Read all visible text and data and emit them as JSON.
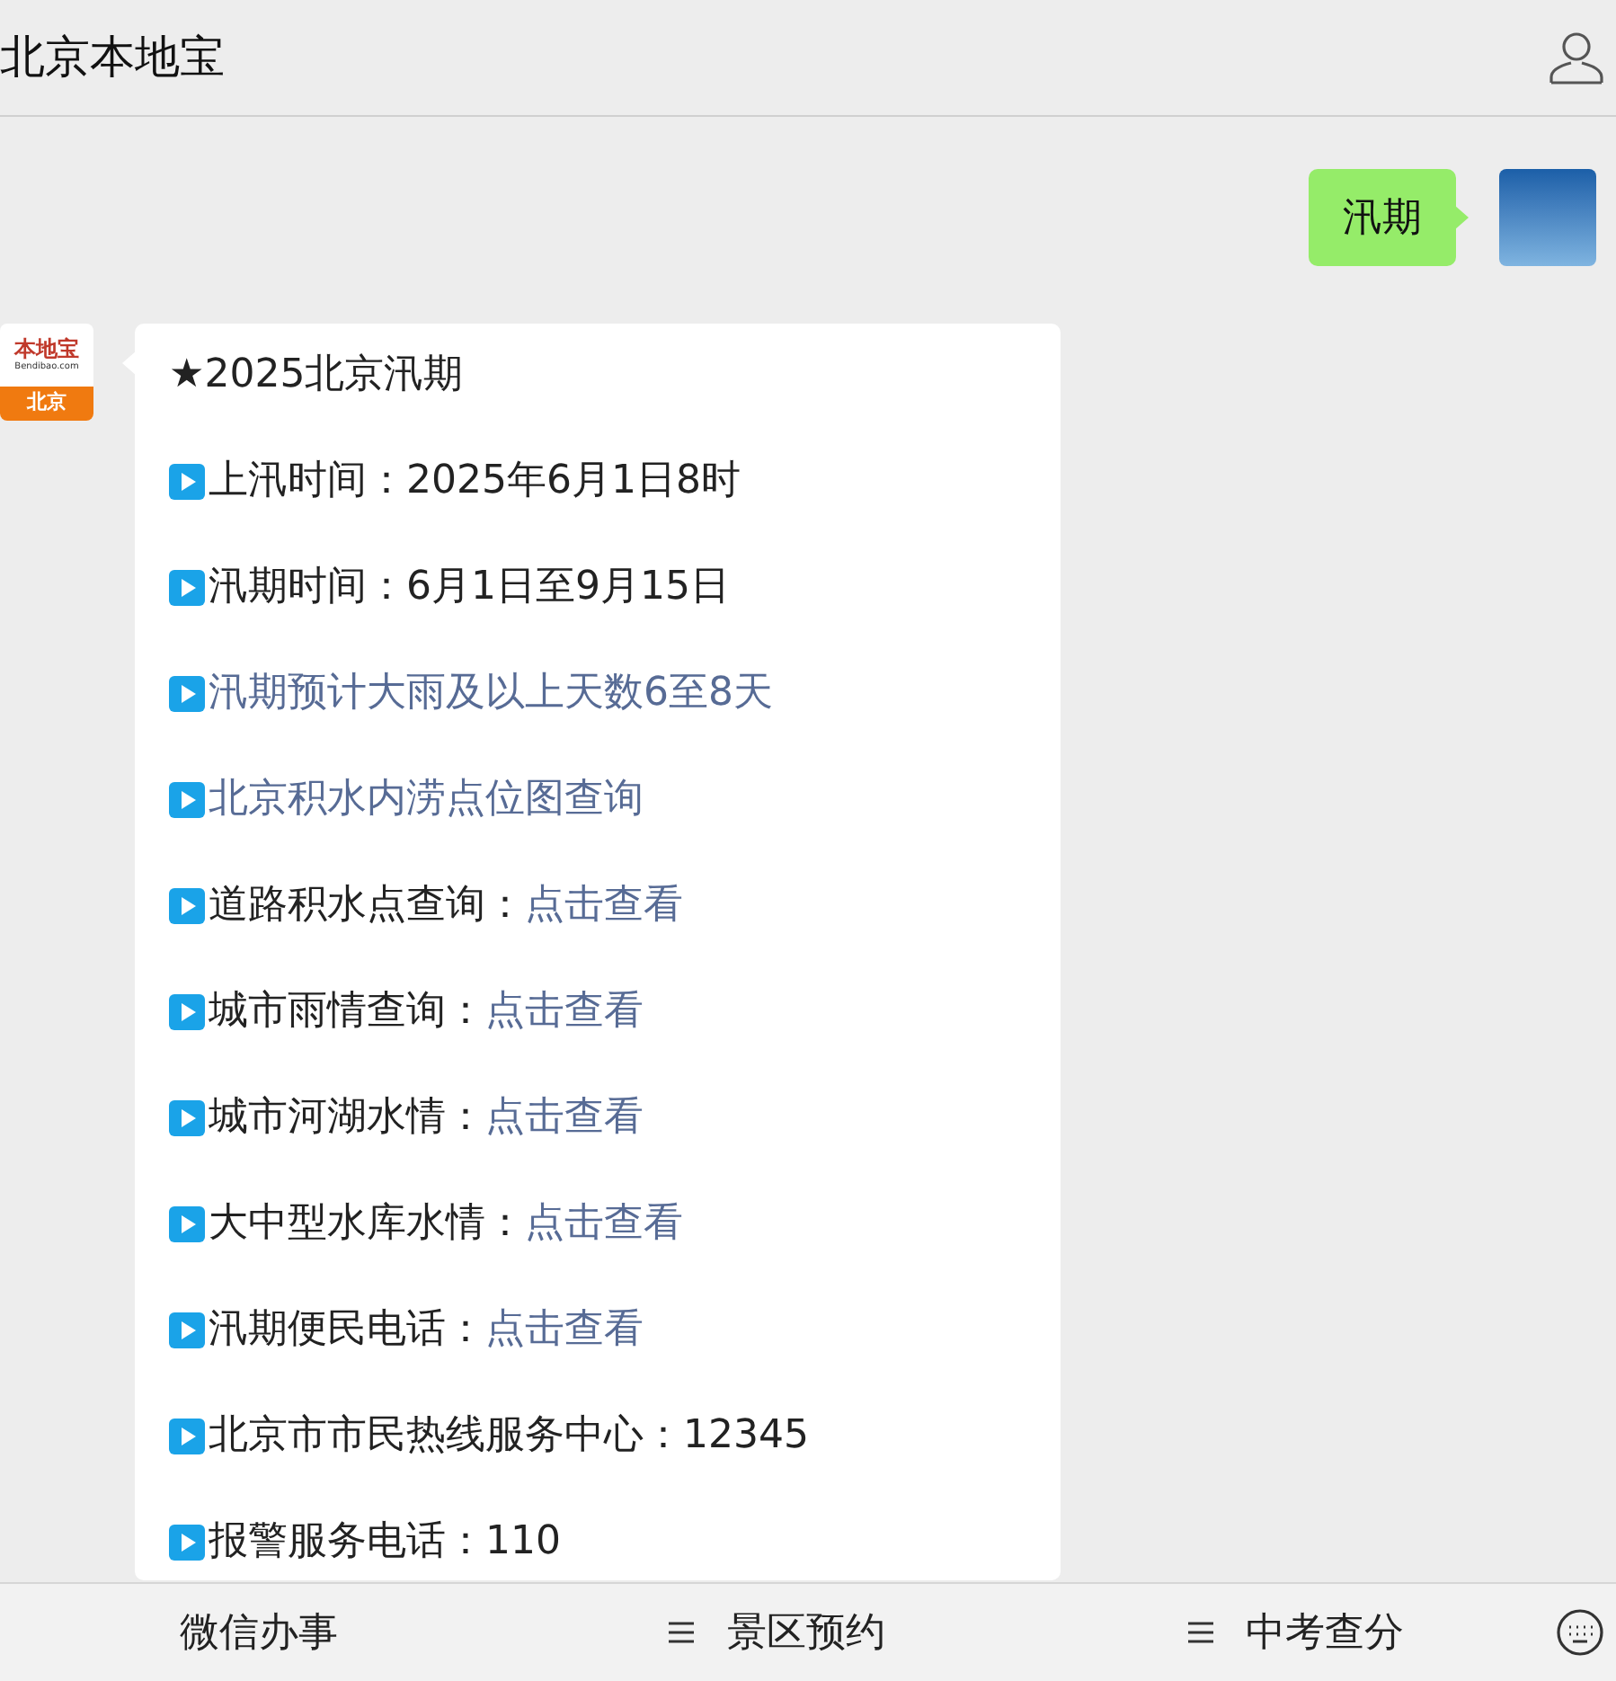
{
  "header": {
    "title": "北京本地宝"
  },
  "messages": [
    {
      "kind": "sent",
      "text": "汛期"
    },
    {
      "kind": "card",
      "logo": {
        "brand": "本地宝",
        "site": "Bendibao.com",
        "city": "北京"
      },
      "title": "★2025北京汛期",
      "lines": [
        {
          "kind": "text",
          "label": "上汛时间：2025年6月1日8时"
        },
        {
          "kind": "text",
          "label": "汛期时间：6月1日至9月15日"
        },
        {
          "kind": "link",
          "label": "汛期预计大雨及以上天数6至8天"
        },
        {
          "kind": "link",
          "label": "北京积水内涝点位图查询"
        },
        {
          "kind": "label_link",
          "label": "道路积水点查询：",
          "link": "点击查看"
        },
        {
          "kind": "label_link",
          "label": "城市雨情查询：",
          "link": "点击查看"
        },
        {
          "kind": "label_link",
          "label": "城市河湖水情：",
          "link": "点击查看"
        },
        {
          "kind": "label_link",
          "label": "大中型水库水情：",
          "link": "点击查看"
        },
        {
          "kind": "label_link",
          "label": "汛期便民电话：",
          "link": "点击查看"
        },
        {
          "kind": "text",
          "label": "北京市市民热线服务中心：12345"
        },
        {
          "kind": "text",
          "label": "报警服务电话：110"
        }
      ]
    }
  ],
  "menu": [
    {
      "label": "微信办事",
      "has_menu": false
    },
    {
      "label": "景区预约",
      "has_menu": true
    },
    {
      "label": "中考查分",
      "has_menu": true
    }
  ]
}
